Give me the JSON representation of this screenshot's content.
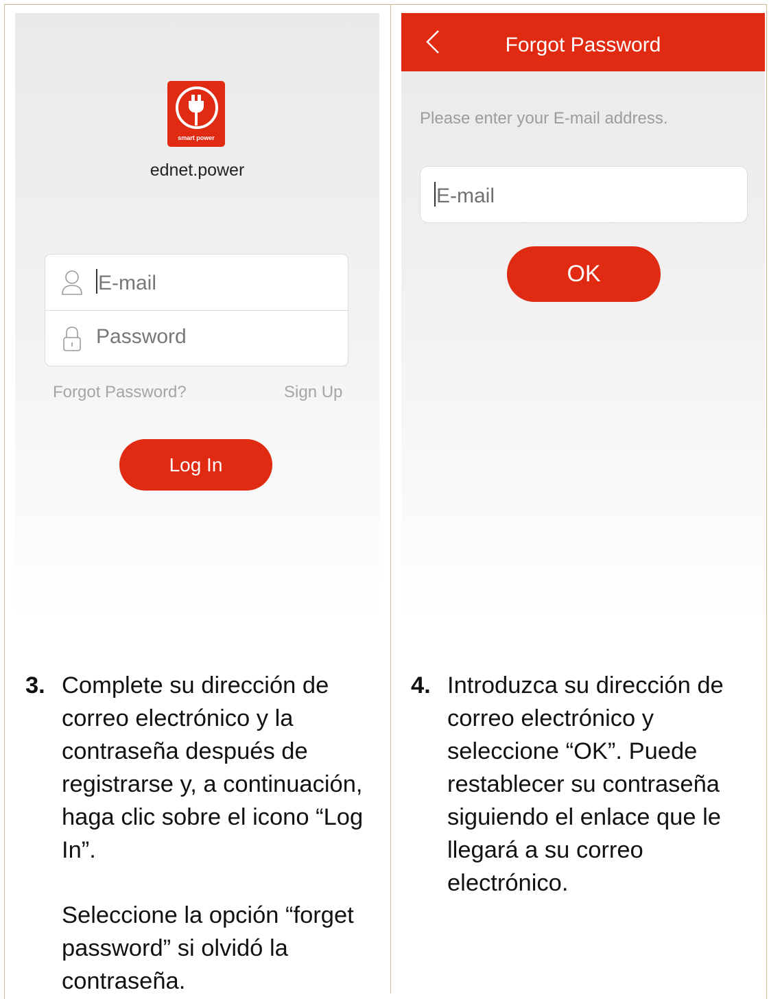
{
  "login_screen": {
    "logo_text": "smart power",
    "app_name": "ednet.power",
    "email_placeholder": "E-mail",
    "password_placeholder": "Password",
    "forgot_link": "Forgot Password?",
    "signup_link": "Sign Up",
    "login_button": "Log In",
    "accent_color": "#e12a12"
  },
  "forgot_screen": {
    "title": "Forgot Password",
    "prompt": "Please enter your E-mail address.",
    "email_placeholder": "E-mail",
    "ok_button": "OK"
  },
  "captions": {
    "step3": {
      "number": "3.",
      "text": "Complete su dirección de correo electrónico y la contraseña después de registrarse y, a continuación, haga clic sobre el icono “Log In”.",
      "extra": "Seleccione la opción “forget password” si olvidó la contraseña."
    },
    "step4": {
      "number": "4.",
      "text": "Introduzca su dirección de correo electrónico y seleccione “OK”. Puede restablecer su contraseña siguiendo el enlace que le llegará a su correo electrónico."
    }
  }
}
